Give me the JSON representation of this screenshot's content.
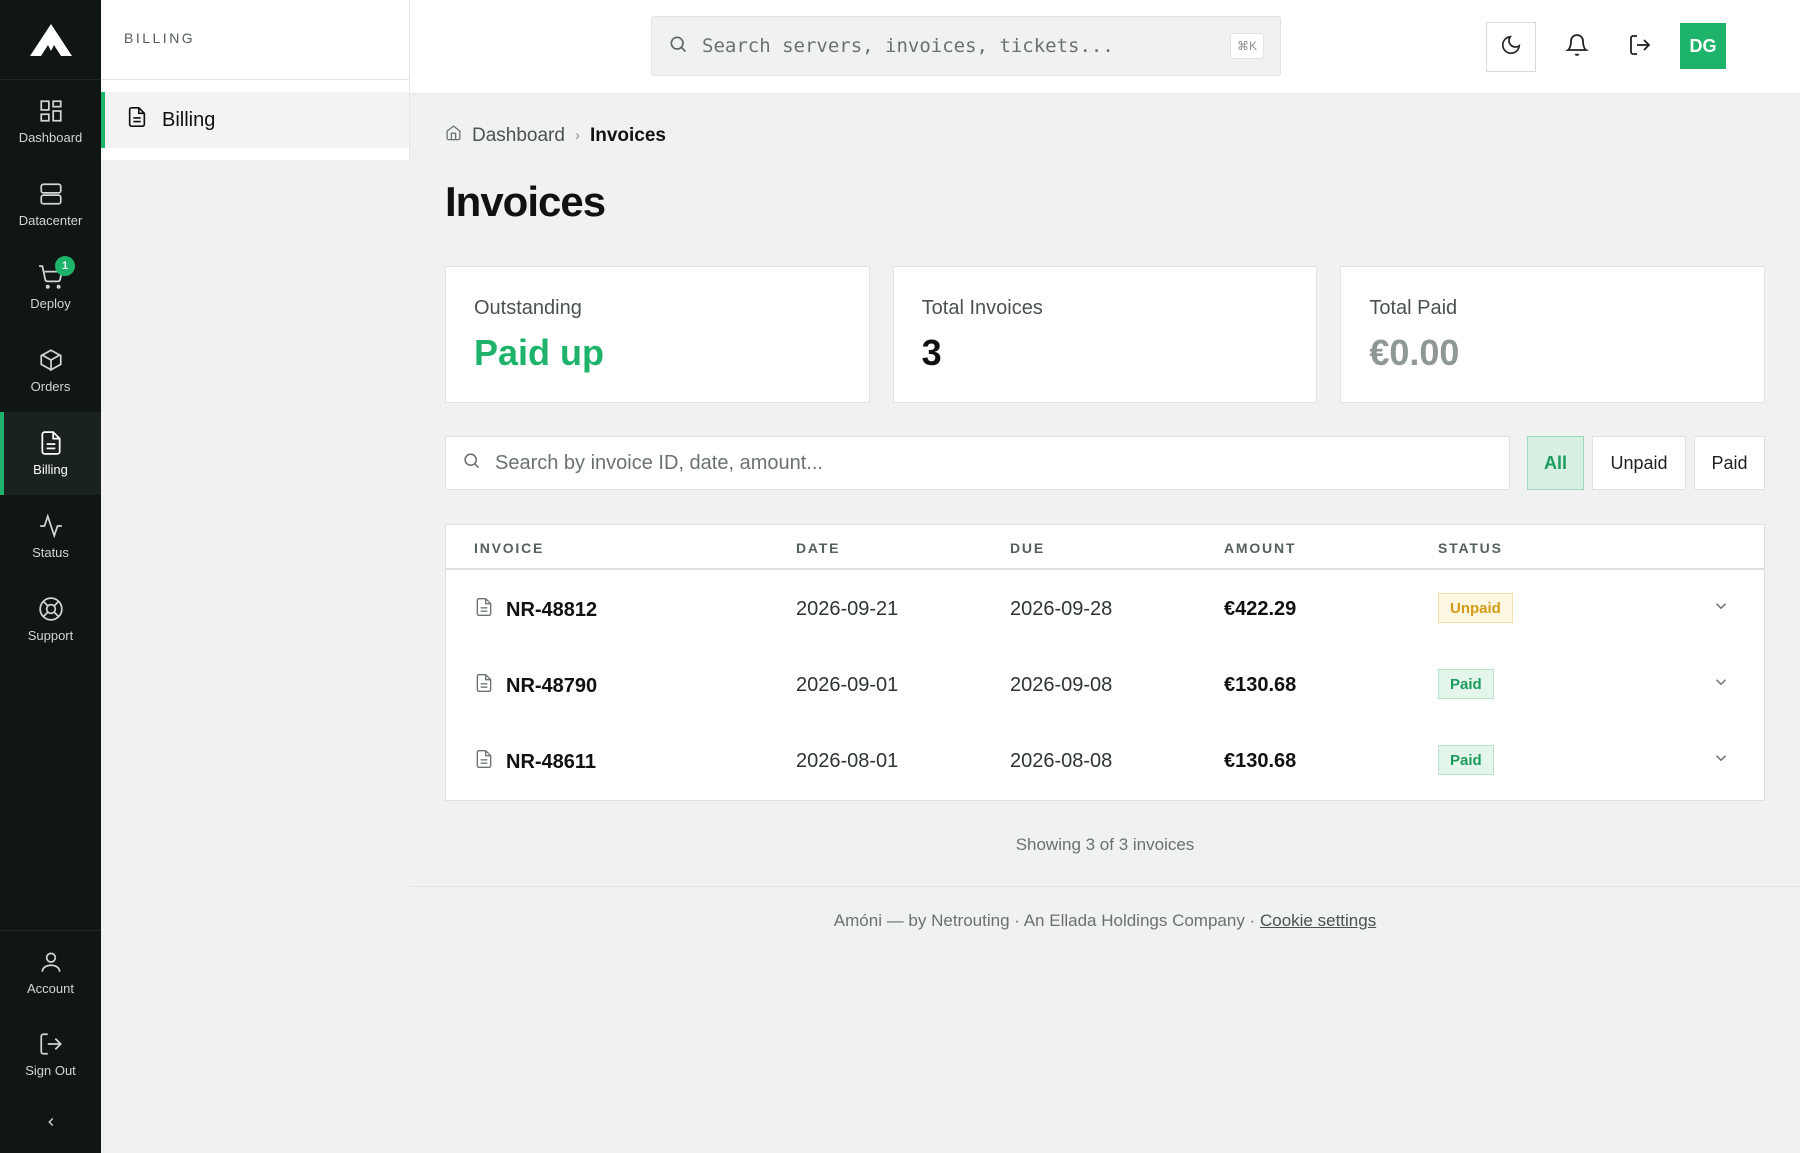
{
  "nav": {
    "items": [
      {
        "label": "Dashboard",
        "icon": "grid-icon"
      },
      {
        "label": "Datacenter",
        "icon": "server-icon"
      },
      {
        "label": "Deploy",
        "icon": "cart-icon",
        "badge": "1"
      },
      {
        "label": "Orders",
        "icon": "box-icon"
      },
      {
        "label": "Billing",
        "icon": "document-icon",
        "active": true
      },
      {
        "label": "Status",
        "icon": "activity-icon"
      },
      {
        "label": "Support",
        "icon": "lifebuoy-icon"
      }
    ],
    "bottom": [
      {
        "label": "Account",
        "icon": "user-icon"
      },
      {
        "label": "Sign Out",
        "icon": "sign-out-icon"
      }
    ]
  },
  "sidebar": {
    "section": "BILLING",
    "items": [
      {
        "label": "Billing",
        "icon": "document-icon"
      }
    ]
  },
  "topbar": {
    "search_placeholder": "Search servers, invoices, tickets...",
    "shortcut": "⌘K",
    "avatar_initials": "DG"
  },
  "breadcrumb": {
    "home": "Dashboard",
    "current": "Invoices"
  },
  "page": {
    "title": "Invoices"
  },
  "summary": {
    "outstanding_label": "Outstanding",
    "outstanding_value": "Paid up",
    "total_invoices_label": "Total Invoices",
    "total_invoices_value": "3",
    "total_paid_label": "Total Paid",
    "total_paid_value": "€0.00"
  },
  "filters": {
    "search_placeholder": "Search by invoice ID, date, amount...",
    "options": [
      "All",
      "Unpaid",
      "Paid"
    ],
    "selected": "All"
  },
  "table": {
    "columns": [
      "INVOICE",
      "DATE",
      "DUE",
      "AMOUNT",
      "STATUS"
    ],
    "rows": [
      {
        "id": "NR-48812",
        "date": "2026-09-21",
        "due": "2026-09-28",
        "amount": "€422.29",
        "status": "Unpaid"
      },
      {
        "id": "NR-48790",
        "date": "2026-09-01",
        "due": "2026-09-08",
        "amount": "€130.68",
        "status": "Paid"
      },
      {
        "id": "NR-48611",
        "date": "2026-08-01",
        "due": "2026-08-08",
        "amount": "€130.68",
        "status": "Paid"
      }
    ],
    "footer": "Showing 3 of 3 invoices"
  },
  "footer": {
    "text": "Amóni — by Netrouting · An Ellada Holdings Company ·",
    "link": "Cookie settings"
  },
  "colors": {
    "accent": "#1db36a",
    "rail_bg": "#0f1614",
    "page_bg": "#eff2f1",
    "unpaid": "#d59a15"
  }
}
